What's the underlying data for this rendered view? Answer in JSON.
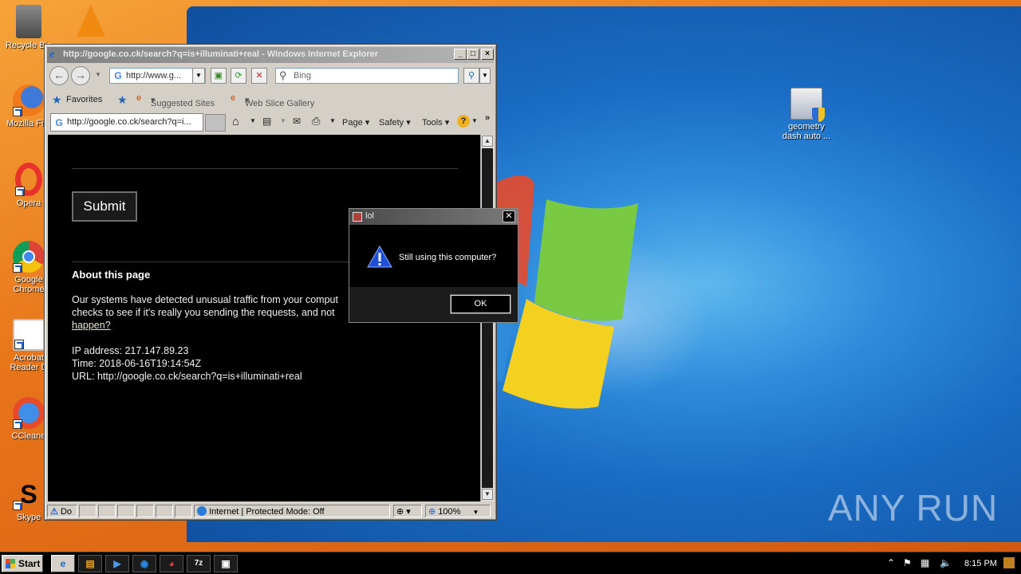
{
  "desktop": {
    "icons": [
      {
        "label": "Recycle Bin",
        "line2": ""
      },
      {
        "label": "Mozilla Fire",
        "line2": ""
      },
      {
        "label": "Opera",
        "line2": ""
      },
      {
        "label": "Google",
        "line2": "Chrome"
      },
      {
        "label": "Acrobat",
        "line2": "Reader D"
      },
      {
        "label": "CCleane",
        "line2": ""
      },
      {
        "label": "Skype",
        "line2": ""
      }
    ],
    "right_icon": {
      "line1": "geometry",
      "line2": "dash auto ..."
    },
    "watermark": "ANY RUN"
  },
  "ie": {
    "window_title": "http://google.co.ck/search?q=is+illuminati+real - Windows Internet Explorer",
    "address": "http://www.g...",
    "search_placeholder": "Bing",
    "favorites_label": "Favorites",
    "suggested_sites": "Suggested Sites",
    "web_slice": "Web Slice Gallery",
    "tab_title": "http://google.co.ck/search?q=i...",
    "commands": {
      "page": "Page",
      "safety": "Safety",
      "tools": "Tools"
    },
    "content": {
      "submit_label": "Submit",
      "about_heading": "About this page",
      "para_line1": "Our systems have detected unusual traffic from your comput",
      "para_line2": "checks to see if it's really you sending the requests, and not",
      "para_link": "happen?",
      "ip_line": "IP address: 217.147.89.23",
      "time_line": "Time: 2018-06-16T19:14:54Z",
      "url_line": "URL: http://google.co.ck/search?q=is+illuminati+real"
    },
    "status": {
      "left": "Do",
      "zone": "Internet | Protected Mode: Off",
      "zoom": "100%"
    }
  },
  "dialog": {
    "title": "lol",
    "message": "Still using this computer?",
    "ok_label": "OK"
  },
  "taskbar": {
    "start_label": "Start",
    "time": "8:15 PM"
  }
}
